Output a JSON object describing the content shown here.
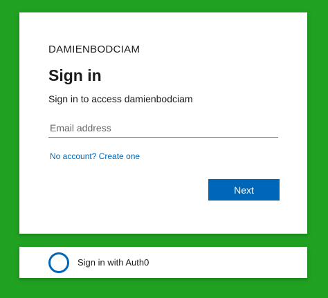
{
  "signin_card": {
    "brand": "DAMIENBODCIAM",
    "title": "Sign in",
    "subtitle": "Sign in to access damienbodciam",
    "email_placeholder": "Email address",
    "email_value": "",
    "create_account_link": "No account? Create one",
    "next_button": "Next"
  },
  "alt_signin": {
    "icon": "circle-icon",
    "label": "Sign in with Auth0"
  },
  "colors": {
    "background": "#21a121",
    "accent": "#0067b8",
    "text": "#1b1b1b"
  }
}
